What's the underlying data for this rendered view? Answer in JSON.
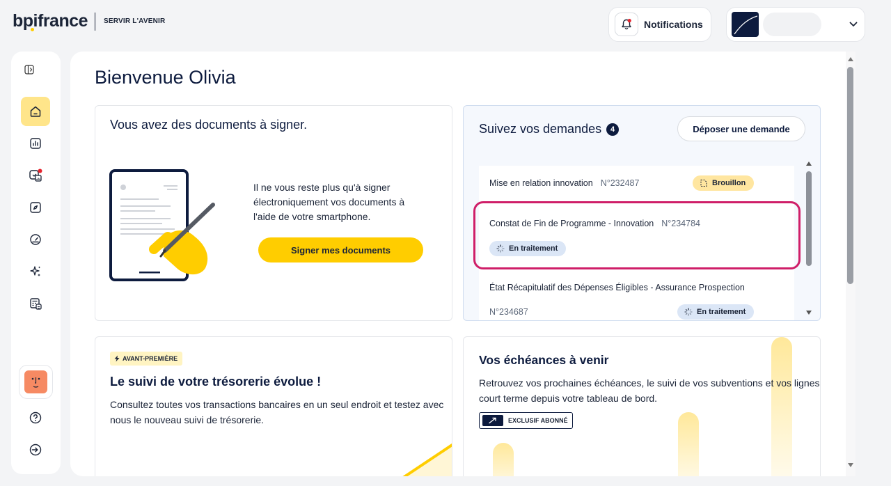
{
  "brand": {
    "name": "bpifrance",
    "tagline": "SERVIR L'AVENIR"
  },
  "header": {
    "notifications_label": "Notifications"
  },
  "page": {
    "title": "Bienvenue Olivia"
  },
  "sign_card": {
    "title": "Vous avez des documents à signer.",
    "text": "Il ne vous reste plus qu'à signer électroniquement vos documents à l'aide de votre smartphone.",
    "button": "Signer mes documents"
  },
  "demandes": {
    "title": "Suivez vos demandes",
    "count": "4",
    "deposer": "Déposer une demande",
    "items": [
      {
        "title": "Mise en relation innovation",
        "number": "N°232487",
        "status": "Brouillon"
      },
      {
        "title": "Constat de Fin de Programme - Innovation",
        "number": "N°234784",
        "status": "En traitement"
      },
      {
        "title": "État Récapitulatif des Dépenses Éligibles - Assurance Prospection",
        "number": "N°234687",
        "status": "En traitement"
      }
    ]
  },
  "tresorerie": {
    "tag": "AVANT-PREMIÈRE",
    "title": "Le suivi de votre trésorerie évolue !",
    "text": "Consultez toutes vos transactions bancaires en un seul endroit et testez avec nous le nouveau suivi de trésorerie."
  },
  "echeances": {
    "title": "Vos échéances à venir",
    "text": "Retrouvez vos prochaines échéances, le suivi de vos subventions et vos lignes court terme depuis votre tableau de bord.",
    "tag": "EXCLUSIF ABONNÉ"
  },
  "sidebar": {
    "icons": [
      "home-icon",
      "chart-icon",
      "finance-icon",
      "compass-icon",
      "gauge-icon",
      "sparkles-icon",
      "calculator-icon"
    ],
    "bottom_icons": [
      "help-icon",
      "logout-icon"
    ]
  },
  "colors": {
    "accent": "#ffcd00",
    "navy": "#0d1b3e",
    "highlight": "#cf1e68",
    "badge_alert": "#e5232d"
  }
}
